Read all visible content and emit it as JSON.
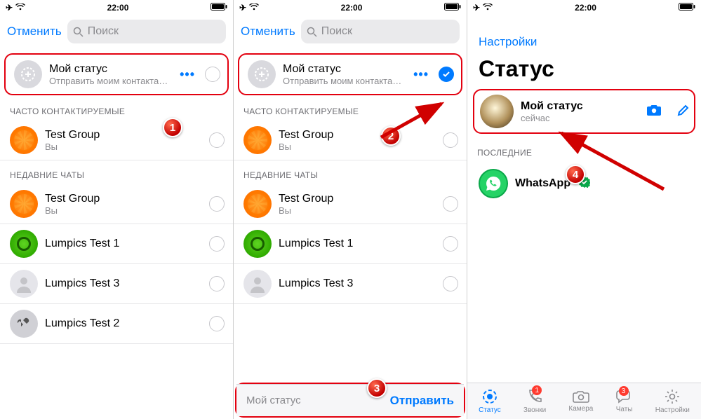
{
  "statusbar": {
    "time": "22:00"
  },
  "panelA": {
    "cancel": "Отменить",
    "search_placeholder": "Поиск",
    "my_status": {
      "title": "Мой статус",
      "subtitle": "Отправить моим контактам, кр…"
    },
    "section_frequent": "ЧАСТО КОНТАКТИРУЕМЫЕ",
    "section_recent": "НЕДАВНИЕ ЧАТЫ",
    "frequent": [
      {
        "title": "Test Group",
        "subtitle": "Вы"
      }
    ],
    "recent": [
      {
        "title": "Test Group",
        "subtitle": "Вы"
      },
      {
        "title": "Lumpics Test 1",
        "subtitle": ""
      },
      {
        "title": "Lumpics Test 3",
        "subtitle": ""
      },
      {
        "title": "Lumpics Test 2",
        "subtitle": ""
      }
    ],
    "badge": "1"
  },
  "panelB": {
    "cancel": "Отменить",
    "search_placeholder": "Поиск",
    "my_status": {
      "title": "Мой статус",
      "subtitle": "Отправить моим контактам, кр…"
    },
    "section_frequent": "ЧАСТО КОНТАКТИРУЕМЫЕ",
    "section_recent": "НЕДАВНИЕ ЧАТЫ",
    "frequent": [
      {
        "title": "Test Group",
        "subtitle": "Вы"
      }
    ],
    "recent": [
      {
        "title": "Test Group",
        "subtitle": "Вы"
      },
      {
        "title": "Lumpics Test 1",
        "subtitle": ""
      },
      {
        "title": "Lumpics Test 3",
        "subtitle": ""
      }
    ],
    "sendbar": {
      "chip": "Мой статус",
      "send": "Отправить"
    },
    "badge_check": "2",
    "badge_send": "3"
  },
  "panelC": {
    "settings": "Настройки",
    "title": "Статус",
    "my_status": {
      "title": "Мой статус",
      "subtitle": "сейчас"
    },
    "section_recent": "ПОСЛЕДНИЕ",
    "whatsapp": "WhatsApp",
    "badge": "4",
    "tabs": {
      "status": "Статус",
      "calls": "Звонки",
      "calls_badge": "1",
      "camera": "Камера",
      "chats": "Чаты",
      "chats_badge": "3",
      "settings": "Настройки"
    }
  }
}
